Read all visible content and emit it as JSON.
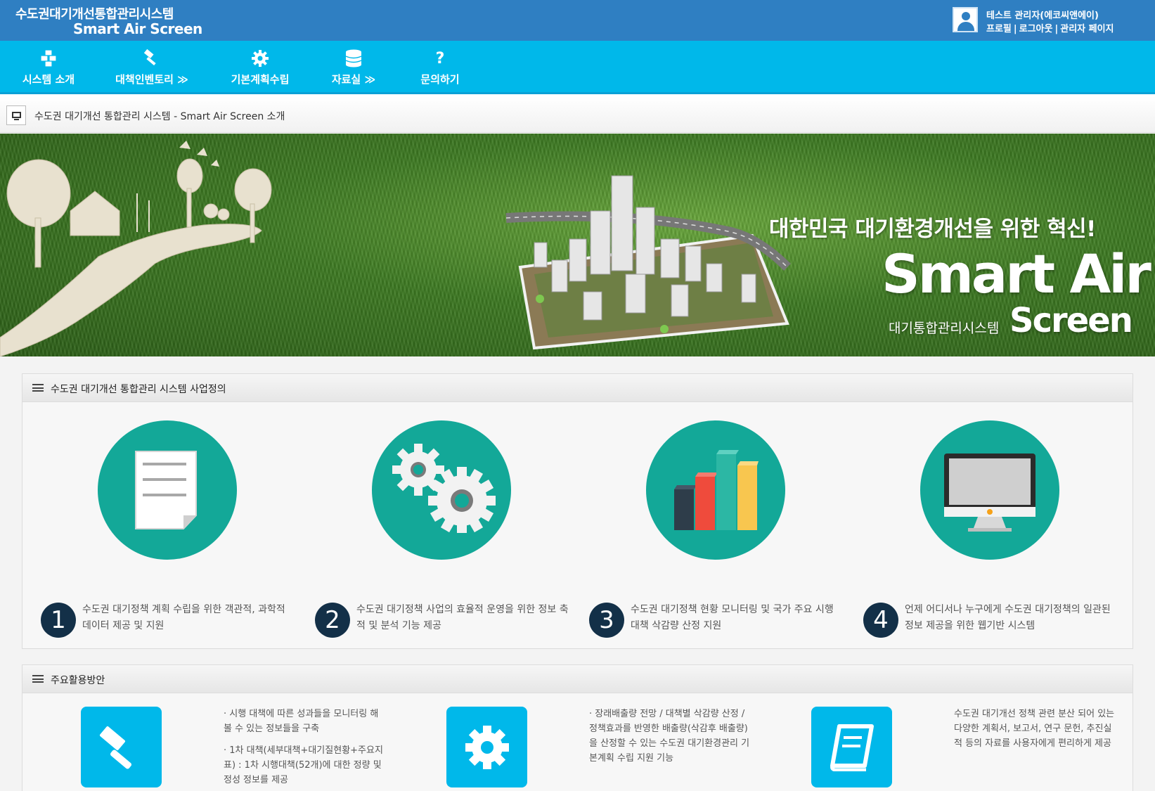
{
  "header": {
    "brand_ko": "수도권대기개선통합관리시스템",
    "brand_en": "Smart Air Screen",
    "user_name": "테스트 관리자(에코씨앤에이)",
    "user_links": [
      "프로필",
      "로그아웃",
      "관리자 페이지"
    ],
    "link_separator": "|"
  },
  "nav": {
    "items": [
      {
        "label": "시스템 소개",
        "icon": "boxes-icon"
      },
      {
        "label": "대책인벤토리 ≫",
        "icon": "gavel-icon"
      },
      {
        "label": "기본계획수립",
        "icon": "gear-icon"
      },
      {
        "label": "자료실 ≫",
        "icon": "database-icon"
      },
      {
        "label": "문의하기",
        "icon": "question-icon"
      }
    ]
  },
  "breadcrumb": {
    "text": "수도권 대기개선 통합관리 시스템 - Smart Air Screen 소개"
  },
  "hero": {
    "tagline": "대한민국 대기환경개선을 위한 혁신!",
    "logo_line1": "Smart Air",
    "logo_sub": "대기통합관리시스템",
    "logo_line2": "Screen"
  },
  "definition": {
    "title": "수도권 대기개선 통합관리 시스템 사업정의",
    "features": [
      {
        "number": "1",
        "icon": "document-icon",
        "text": "수도권 대기정책 계획 수립을 위한 객관적, 과학적 데이터 제공 및 지원"
      },
      {
        "number": "2",
        "icon": "gears-icon",
        "text": "수도권 대기정책 사업의 효율적 운영을 위한 정보 축적 및 분석 기능 제공"
      },
      {
        "number": "3",
        "icon": "bar-chart-icon",
        "text": "수도권 대기정책 현황 모니터링 및 국가 주요 시행 대책 삭감량 산정 지원"
      },
      {
        "number": "4",
        "icon": "monitor-icon",
        "text": "언제 어디서나 누구에게 수도권 대기정책의 일관된 정보 제공을 위한 웹기반 시스템"
      }
    ]
  },
  "usage": {
    "title": "주요활용방안",
    "items": [
      {
        "icon": "gavel-icon",
        "paragraphs": [
          "· 시행 대책에 따른 성과들을 모니터링 해 볼 수 있는 정보들을 구축",
          "· 1차 대책(세부대책+대기질현황+주요지표) : 1차 시행대책(52개)에 대한 정량 및 정성 정보를 제공"
        ]
      },
      {
        "icon": "gear-icon",
        "paragraphs": [
          "· 장래배출량 전망 / 대책별 삭감량 산정 / 정책효과를 반영한 배출량(삭감후 배출량)을 산정할 수 있는 수도권 대기환경관리 기본계획 수립 지원 기능"
        ]
      },
      {
        "icon": "book-icon",
        "paragraphs": [
          "수도권 대기개선 정책 관련 분산 되어 있는 다양한 계획서, 보고서, 연구 문헌, 추진실적 등의 자료를 사용자에게 편리하게 제공"
        ]
      }
    ]
  },
  "colors": {
    "header_blue": "#2f7fc2",
    "nav_cyan": "#00b8ea",
    "teal_circle": "#13a898",
    "number_navy": "#133048"
  }
}
